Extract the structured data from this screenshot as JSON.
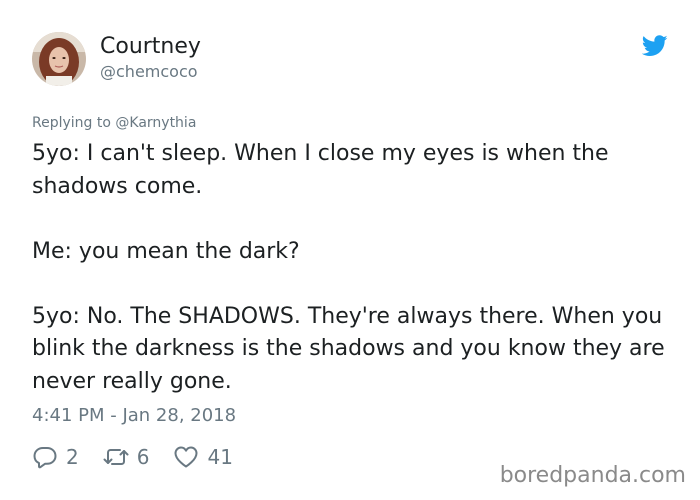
{
  "user": {
    "display_name": "Courtney",
    "handle": "@chemcoco"
  },
  "reply": {
    "prefix": "Replying to ",
    "to": "@Karnythia"
  },
  "tweet": {
    "lines": [
      "5yo: I can't sleep. When I close my eyes is when the shadows come.",
      "Me: you mean the dark?",
      "5yo: No. The SHADOWS. They're always there. When you blink the darkness is the shadows and you know they are never really gone."
    ],
    "timestamp": "4:41 PM - Jan 28, 2018"
  },
  "actions": {
    "replies": "2",
    "retweets": "6",
    "likes": "41"
  },
  "watermark": "boredpanda.com",
  "icons": {
    "bird": "twitter-bird-icon",
    "reply": "reply-icon",
    "retweet": "retweet-icon",
    "like": "heart-icon"
  },
  "colors": {
    "brand": "#1da1f2",
    "text": "#1c2022",
    "muted": "#697882"
  }
}
